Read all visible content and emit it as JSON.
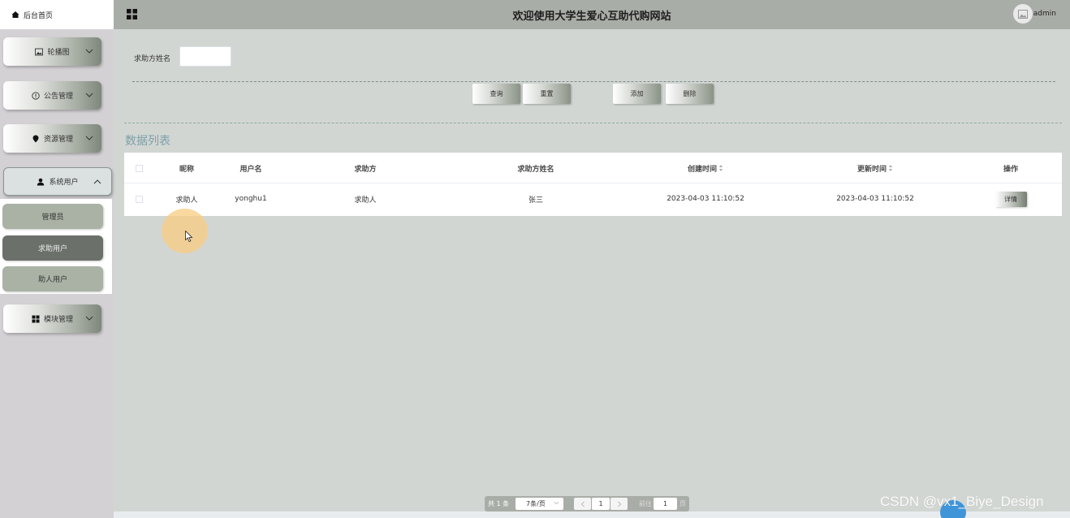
{
  "header": {
    "title": "欢迎使用大学生爱心互助代购网站",
    "user": "admin"
  },
  "sidebar": {
    "home": "后台首页",
    "menus": [
      {
        "label": "轮播图"
      },
      {
        "label": "公告管理"
      },
      {
        "label": "资源管理"
      },
      {
        "label": "系统用户"
      },
      {
        "label": "模块管理"
      }
    ],
    "submenu": [
      "管理员",
      "求助用户",
      "助人用户"
    ]
  },
  "search": {
    "label": "求助方姓名",
    "value": "",
    "buttons": {
      "query": "查询",
      "reset": "重置",
      "add": "添加",
      "delete": "删除"
    }
  },
  "list": {
    "title": "数据列表",
    "columns": [
      "昵称",
      "用户名",
      "求助方",
      "求助方姓名",
      "创建时间",
      "更新时间",
      "操作"
    ],
    "rows": [
      {
        "nickname": "求助人",
        "username": "yonghu1",
        "helpee": "求助人",
        "helpee_name": "张三",
        "created": "2023-04-03 11:10:52",
        "updated": "2023-04-03 11:10:52",
        "action": "详情"
      }
    ]
  },
  "pagination": {
    "total": "共 1 条",
    "page_size": "7条/页",
    "current": "1",
    "goto_label": "前往",
    "goto_value": "1",
    "page_label": "页"
  },
  "watermark": "CSDN @vx1_Biye_Design"
}
